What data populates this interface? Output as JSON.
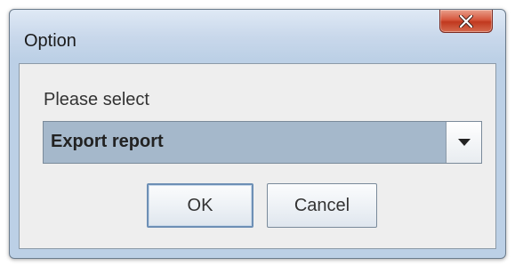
{
  "dialog": {
    "title": "Option",
    "close_icon": "close-icon",
    "prompt": "Please select",
    "select": {
      "value": "Export report",
      "arrow_icon": "chevron-down-icon"
    },
    "buttons": {
      "ok": "OK",
      "cancel": "Cancel"
    }
  },
  "colors": {
    "selection": "#a5b8cb",
    "close_button": "#c0391f",
    "frame": "#bcd0e6"
  }
}
